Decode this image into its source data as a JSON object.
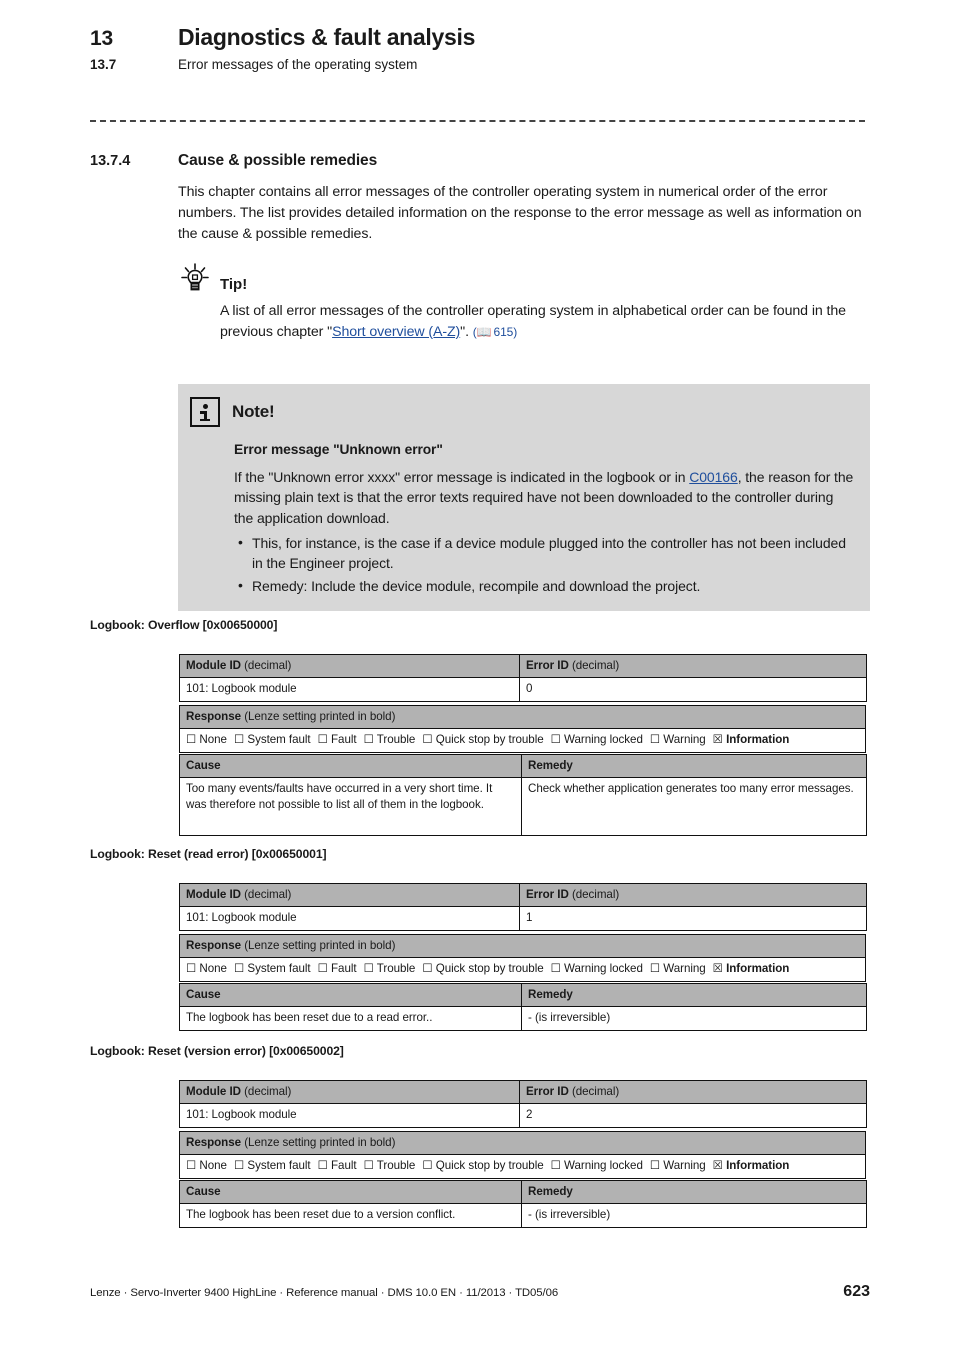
{
  "running_head": {
    "chapter_number": "13",
    "chapter_title": "Diagnostics & fault analysis",
    "section_number": "13.7",
    "section_title": "Error messages of the operating system"
  },
  "section": {
    "number": "13.7.4",
    "title": "Cause & possible remedies",
    "intro": "This chapter contains all error messages of the controller operating system in numerical order of the error numbers. The list provides detailed information on the response to the error message as well as information on the cause & possible remedies."
  },
  "tip": {
    "icon": "lightbulb-icon",
    "title": "Tip!",
    "text_before_link": "A list of all error messages of the controller operating system in alphabetical order can be found in the previous chapter \"",
    "link_text": "Short overview (A-Z)",
    "text_after_link": "\".",
    "page_ref_icon": "book-icon",
    "page_ref": "615",
    "link_color": "#1f4e9c"
  },
  "note": {
    "icon": "info-icon",
    "title": "Note!",
    "subtitle": "Error message \"Unknown error\"",
    "paragraph_before_link": "If the \"Unknown error xxxx\" error message is indicated in the logbook or in ",
    "link_text": "C00166",
    "paragraph_after_link": ", the reason for the missing plain text is that the error texts required have not been downloaded to the controller during the application download.",
    "bullets": [
      "This, for instance, is the case if a device module plugged into the controller has not been included in the Engineer project.",
      "Remedy: Include the device module, recompile and download the project."
    ],
    "background_color": "#d7d7d7"
  },
  "table_labels": {
    "module_id_label": "Module ID",
    "module_id_unit": "(decimal)",
    "error_id_label": "Error ID",
    "error_id_unit": "(decimal)",
    "response_label": "Response",
    "response_note": "(Lenze setting printed in bold)",
    "cause_label": "Cause",
    "remedy_label": "Remedy",
    "header_color": "#b2b2b2"
  },
  "response_options": [
    {
      "label": "None",
      "checked": false
    },
    {
      "label": "System fault",
      "checked": false
    },
    {
      "label": "Fault",
      "checked": false
    },
    {
      "label": "Trouble",
      "checked": false
    },
    {
      "label": "Quick stop by trouble",
      "checked": false
    },
    {
      "label": "Warning locked",
      "checked": false
    },
    {
      "label": "Warning",
      "checked": false
    },
    {
      "label": "Information",
      "checked": true
    }
  ],
  "checkbox_glyphs": {
    "unchecked": "☐",
    "checked": "☒"
  },
  "error_blocks": [
    {
      "caption": "Logbook: Overflow [0x00650000]",
      "module_id": "101: Logbook module",
      "error_id": "0",
      "cause": "Too many events/faults have occurred in a very short time. It was therefore not possible to list all of them in the logbook.",
      "remedy": "Check whether application generates too many error messages."
    },
    {
      "caption": "Logbook: Reset (read error) [0x00650001]",
      "module_id": "101: Logbook module",
      "error_id": "1",
      "cause": "The logbook has been reset due to a read error..",
      "remedy": "- (is irreversible)"
    },
    {
      "caption": "Logbook: Reset (version error) [0x00650002]",
      "module_id": "101: Logbook module",
      "error_id": "2",
      "cause": "The logbook has been reset due to a version conflict.",
      "remedy": "- (is irreversible)"
    }
  ],
  "footer": {
    "left": "Lenze · Servo-Inverter 9400 HighLine · Reference manual · DMS 10.0 EN · 11/2013 · TD05/06",
    "page_number": "623"
  }
}
